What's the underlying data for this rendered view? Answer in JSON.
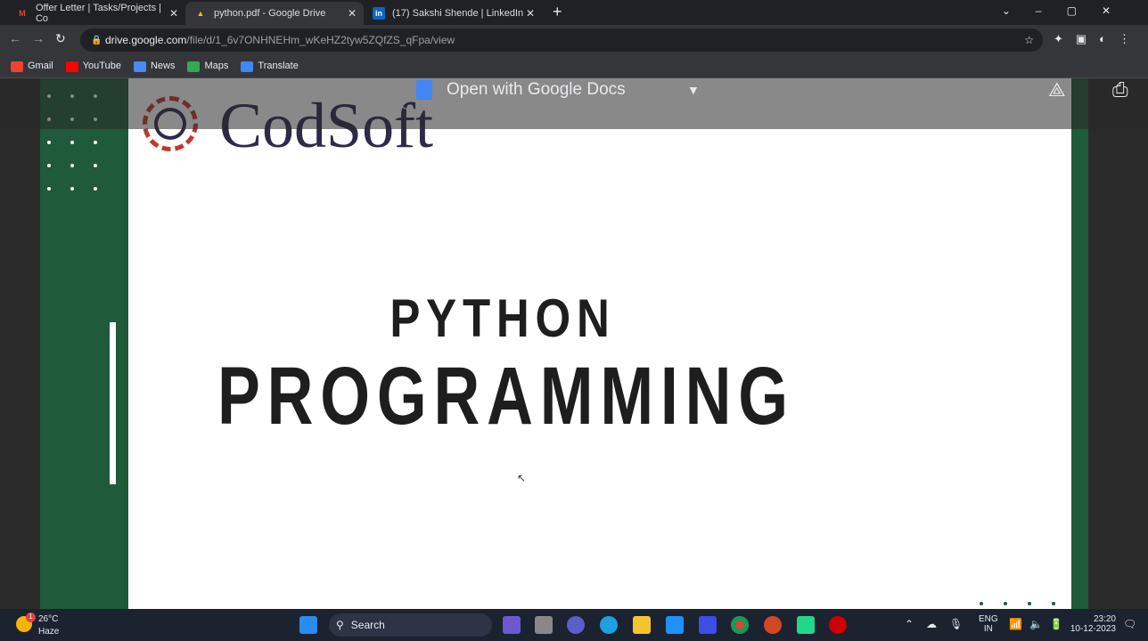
{
  "tabs": [
    {
      "label": "Offer Letter | Tasks/Projects | Co",
      "icon": "gmail-icon"
    },
    {
      "label": "python.pdf - Google Drive",
      "icon": "drive-icon"
    },
    {
      "label": "(17) Sakshi Shende | LinkedIn",
      "icon": "linkedin-icon"
    }
  ],
  "address": {
    "host": "drive.google.com",
    "path": "/file/d/1_6v7ONHNEHm_wKeHZ2tyw5ZQfZS_qFpa/view"
  },
  "bookmarks": [
    "Gmail",
    "YouTube",
    "News",
    "Maps",
    "Translate"
  ],
  "viewer": {
    "open_with": "Open with Google Docs"
  },
  "pdf": {
    "logo": "CodSoft",
    "line1": "PYTHON",
    "line2": "PROGRAMMING"
  },
  "taskbar": {
    "temp": "26°C",
    "weather": "Haze",
    "badge": "1",
    "search": "Search",
    "lang1": "ENG",
    "lang2": "IN",
    "time": "23:20",
    "date": "10-12-2023"
  }
}
